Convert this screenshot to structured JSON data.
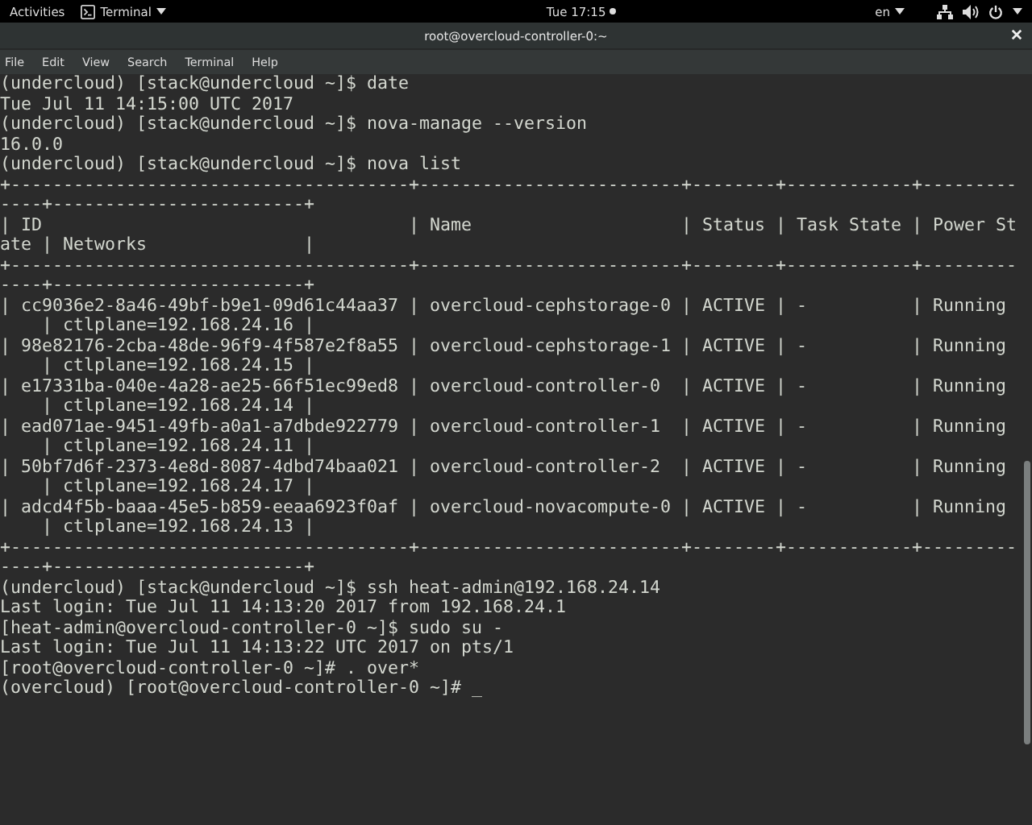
{
  "top_bar": {
    "activities": "Activities",
    "app_menu": "Terminal",
    "clock": "Tue 17:15",
    "language": "en"
  },
  "window": {
    "title": "root@overcloud-controller-0:~"
  },
  "menu": [
    "File",
    "Edit",
    "View",
    "Search",
    "Terminal",
    "Help"
  ],
  "terminal_lines": [
    "(undercloud) [stack@undercloud ~]$ date",
    "Tue Jul 11 14:15:00 UTC 2017",
    "(undercloud) [stack@undercloud ~]$ nova-manage --version",
    "16.0.0",
    "(undercloud) [stack@undercloud ~]$ nova list",
    "+--------------------------------------+-------------------------+--------+------------+---------",
    "----+------------------------+",
    "| ID                                   | Name                    | Status | Task State | Power St",
    "ate | Networks               |",
    "+--------------------------------------+-------------------------+--------+------------+---------",
    "----+------------------------+",
    "| cc9036e2-8a46-49bf-b9e1-09d61c44aa37 | overcloud-cephstorage-0 | ACTIVE | -          | Running ",
    "    | ctlplane=192.168.24.16 |",
    "| 98e82176-2cba-48de-96f9-4f587e2f8a55 | overcloud-cephstorage-1 | ACTIVE | -          | Running ",
    "    | ctlplane=192.168.24.15 |",
    "| e17331ba-040e-4a28-ae25-66f51ec99ed8 | overcloud-controller-0  | ACTIVE | -          | Running ",
    "    | ctlplane=192.168.24.14 |",
    "| ead071ae-9451-49fb-a0a1-a7dbde922779 | overcloud-controller-1  | ACTIVE | -          | Running ",
    "    | ctlplane=192.168.24.11 |",
    "| 50bf7d6f-2373-4e8d-8087-4dbd74baa021 | overcloud-controller-2  | ACTIVE | -          | Running ",
    "    | ctlplane=192.168.24.17 |",
    "| adcd4f5b-baaa-45e5-b859-eeaa6923f0af | overcloud-novacompute-0 | ACTIVE | -          | Running ",
    "    | ctlplane=192.168.24.13 |",
    "+--------------------------------------+-------------------------+--------+------------+---------",
    "----+------------------------+",
    "(undercloud) [stack@undercloud ~]$ ssh heat-admin@192.168.24.14",
    "Last login: Tue Jul 11 14:13:20 2017 from 192.168.24.1",
    "[heat-admin@overcloud-controller-0 ~]$ sudo su -",
    "Last login: Tue Jul 11 14:13:22 UTC 2017 on pts/1",
    "[root@overcloud-controller-0 ~]# . over*",
    "(overcloud) [root@overcloud-controller-0 ~]# _"
  ]
}
